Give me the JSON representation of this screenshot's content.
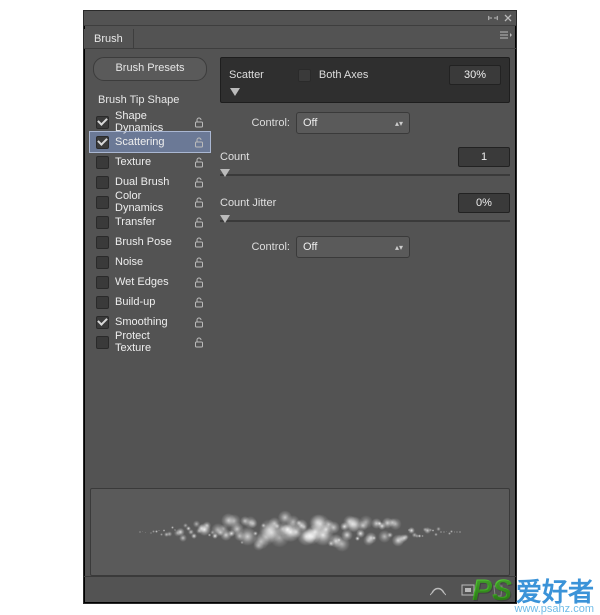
{
  "panel": {
    "tab": "Brush",
    "presets_button": "Brush Presets",
    "tip_shape": "Brush Tip Shape",
    "options": [
      {
        "label": "Shape Dynamics",
        "checked": true,
        "locked": true,
        "selected": false
      },
      {
        "label": "Scattering",
        "checked": true,
        "locked": true,
        "selected": true
      },
      {
        "label": "Texture",
        "checked": false,
        "locked": true,
        "selected": false
      },
      {
        "label": "Dual Brush",
        "checked": false,
        "locked": true,
        "selected": false
      },
      {
        "label": "Color Dynamics",
        "checked": false,
        "locked": true,
        "selected": false
      },
      {
        "label": "Transfer",
        "checked": false,
        "locked": true,
        "selected": false
      },
      {
        "label": "Brush Pose",
        "checked": false,
        "locked": true,
        "selected": false
      },
      {
        "label": "Noise",
        "checked": false,
        "locked": true,
        "selected": false
      },
      {
        "label": "Wet Edges",
        "checked": false,
        "locked": true,
        "selected": false
      },
      {
        "label": "Build-up",
        "checked": false,
        "locked": true,
        "selected": false
      },
      {
        "label": "Smoothing",
        "checked": true,
        "locked": true,
        "selected": false
      },
      {
        "label": "Protect Texture",
        "checked": false,
        "locked": true,
        "selected": false
      }
    ]
  },
  "settings": {
    "scatter_label": "Scatter",
    "both_axes_label": "Both Axes",
    "both_axes_checked": false,
    "scatter_value": "30%",
    "control_label": "Control:",
    "control_value": "Off",
    "count_label": "Count",
    "count_value": "1",
    "count_jitter_label": "Count Jitter",
    "count_jitter_value": "0%",
    "control2_label": "Control:",
    "control2_value": "Off"
  },
  "watermark": {
    "ps": "PS",
    "zh": "爱好者",
    "url": "www.psahz.com"
  }
}
